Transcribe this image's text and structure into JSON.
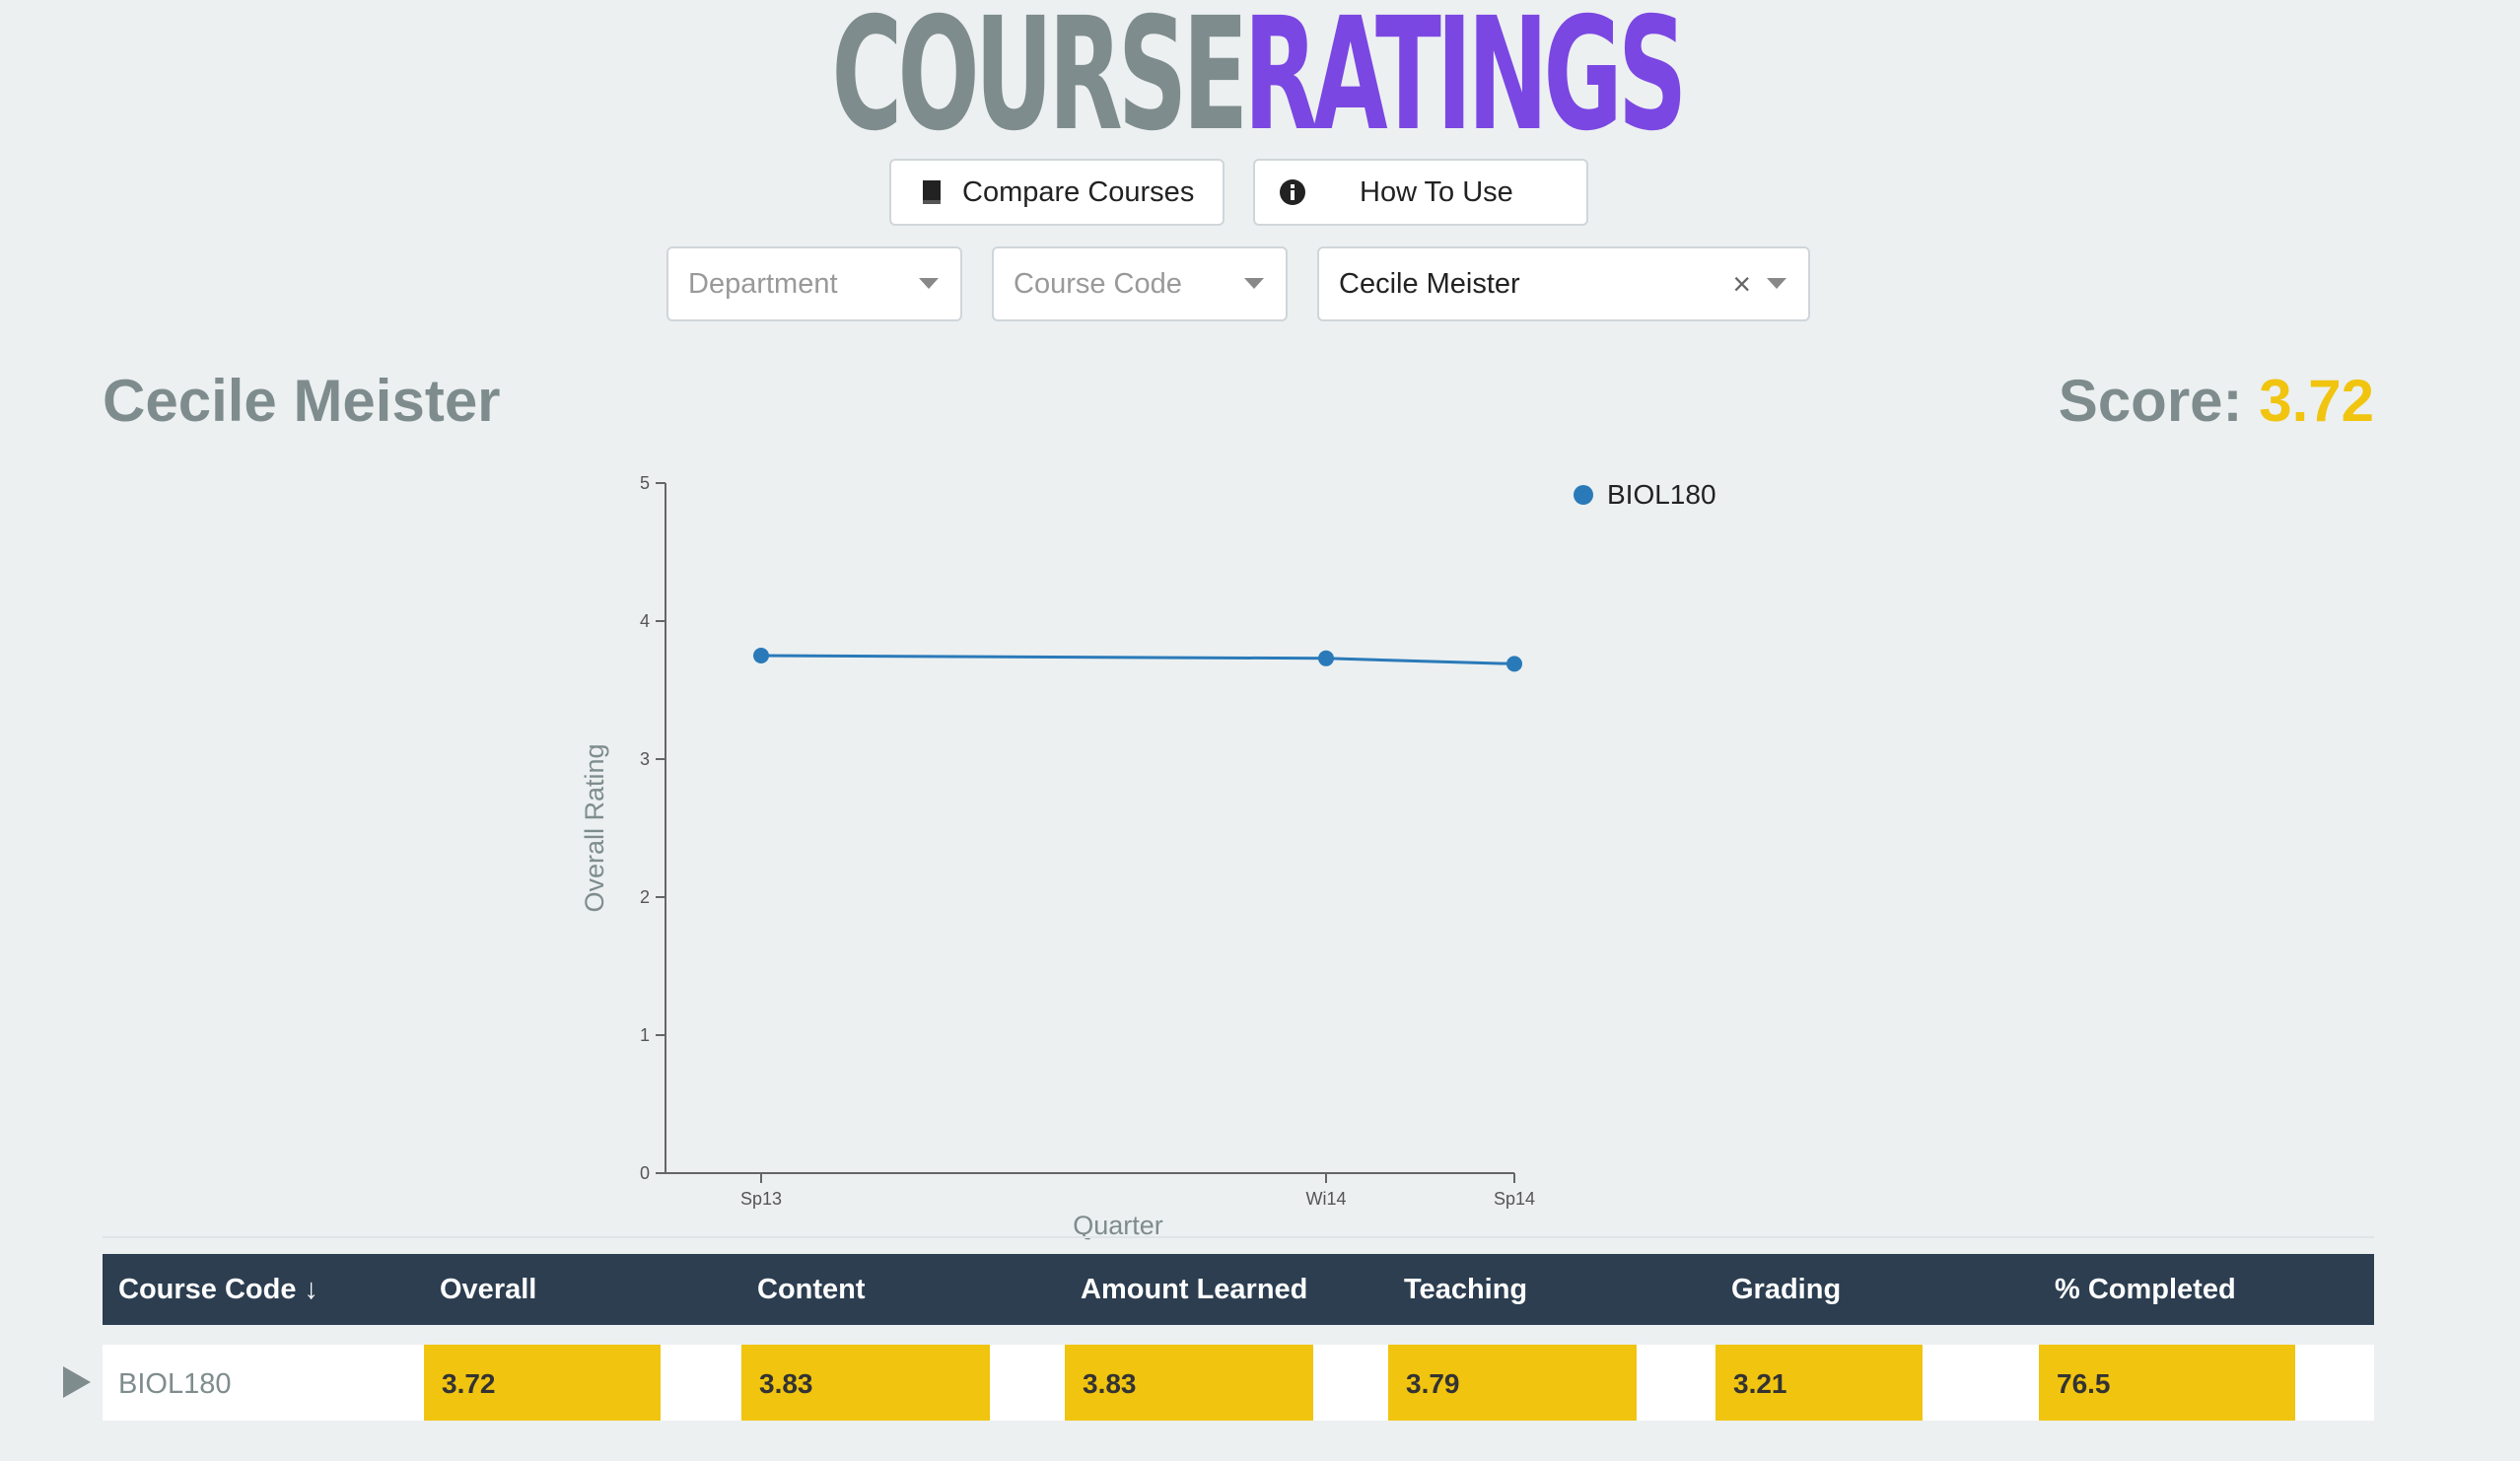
{
  "logo": {
    "part1": "COURSE",
    "part2": "RATINGS"
  },
  "toolbar": {
    "compare_label": "Compare Courses",
    "howto_label": "How To Use"
  },
  "filters": {
    "department_placeholder": "Department",
    "course_code_placeholder": "Course Code",
    "instructor_value": "Cecile Meister",
    "clear_glyph": "×"
  },
  "profile": {
    "name": "Cecile Meister",
    "score_label": "Score:",
    "score_value": "3.72"
  },
  "chart_data": {
    "type": "line",
    "x": [
      "Sp13",
      "Wi14",
      "Sp14"
    ],
    "series": [
      {
        "name": "BIOL180",
        "values": [
          3.75,
          3.73,
          3.69
        ],
        "color": "#2a7ab9"
      }
    ],
    "xlabel": "Quarter",
    "ylabel": "Overall Rating",
    "ylim": [
      0,
      5
    ],
    "yticks": [
      0,
      1,
      2,
      3,
      4,
      5
    ],
    "legend": "top-right",
    "grid": false
  },
  "table": {
    "headers": [
      "Course Code ↓",
      "Overall",
      "Content",
      "Amount Learned",
      "Teaching",
      "Grading",
      "% Completed"
    ],
    "rows": [
      {
        "course_code": "BIOL180",
        "values": [
          "3.72",
          "3.83",
          "3.83",
          "3.79",
          "3.21",
          "76.5"
        ]
      }
    ],
    "highlight_color": "#f1c40f"
  }
}
